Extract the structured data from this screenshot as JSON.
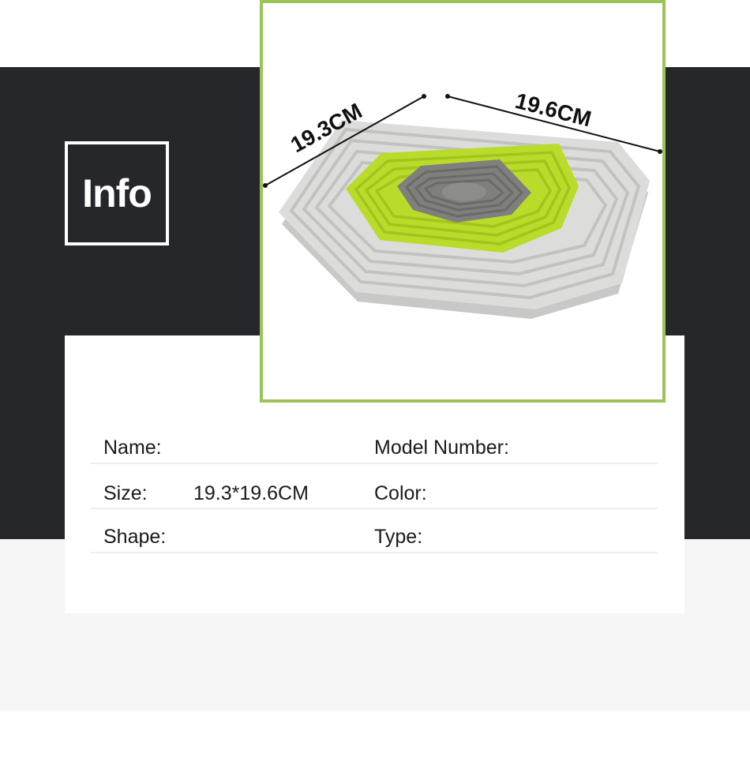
{
  "header": {
    "info_label": "Info"
  },
  "product": {
    "width_label": "19.3CM",
    "depth_label": "19.6CM",
    "colors": {
      "frame": "#9cc35a",
      "outer": "#d9d9d7",
      "middle": "#b9db2a",
      "inner": "#7f7f7d"
    }
  },
  "specs": {
    "name_label": "Name:",
    "name_value": "",
    "model_label": "Model Number:",
    "model_value": "",
    "size_label": "Size:",
    "size_value": "19.3*19.6CM",
    "color_label": "Color:",
    "color_value": "",
    "shape_label": "Shape:",
    "shape_value": "",
    "type_label": "Type:",
    "type_value": ""
  }
}
